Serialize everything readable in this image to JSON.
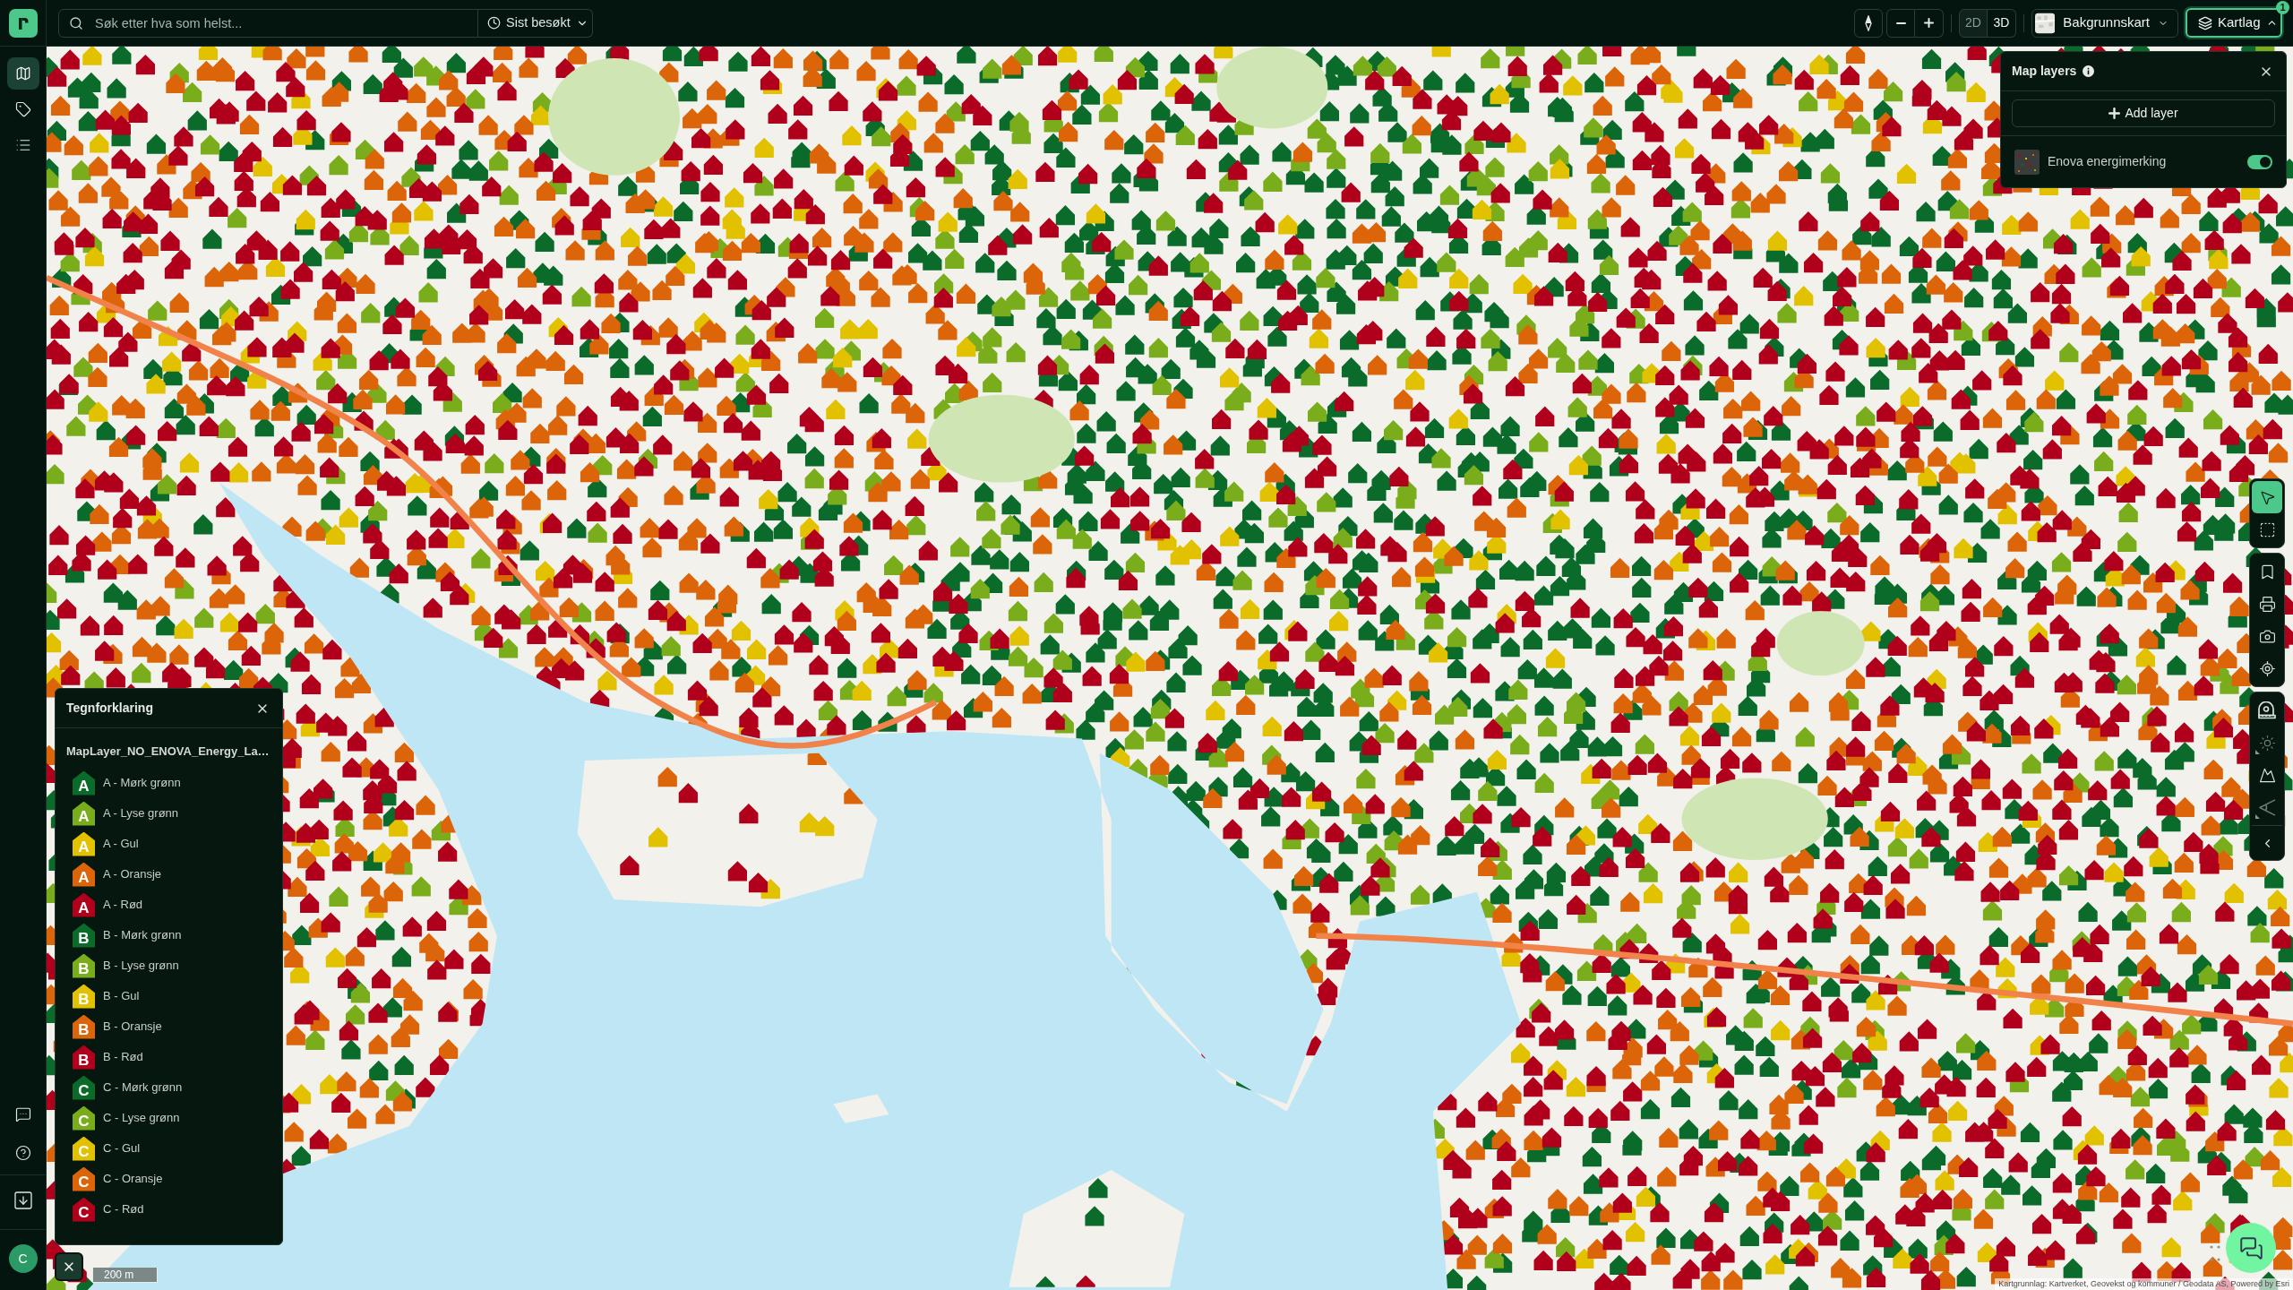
{
  "top_bar": {
    "search": {
      "placeholder": "Søk etter hva som helst...",
      "recent_label": "Sist besøkt"
    },
    "view_modes": [
      {
        "label": "2D",
        "selected": true
      },
      {
        "label": "3D",
        "selected": false
      }
    ],
    "basemap": {
      "label": "Bakgrunnskart",
      "expanded": false
    },
    "layers_button": {
      "label": "Kartlag",
      "expanded": true,
      "badge": "1"
    }
  },
  "sidebar": {
    "nav": [
      {
        "selected": true
      },
      {
        "selected": false
      },
      {
        "selected": false
      }
    ],
    "user": {
      "initial": "C"
    }
  },
  "layers_panel": {
    "title": "Map layers",
    "add_label": "Add layer",
    "layers": [
      {
        "name": "Enova energimerking",
        "on": true
      }
    ]
  },
  "legend": {
    "title": "Tegnforklaring",
    "layer_name": "MapLayer_NO_ENOVA_Energy_La…",
    "items": [
      {
        "letter": "A",
        "label": "A - Mørk grønn",
        "color": "#0b6b2b"
      },
      {
        "letter": "A",
        "label": "A - Lyse grønn",
        "color": "#7aad1b"
      },
      {
        "letter": "A",
        "label": "A - Gul",
        "color": "#e2c100"
      },
      {
        "letter": "A",
        "label": "A - Oransje",
        "color": "#dc6409"
      },
      {
        "letter": "A",
        "label": "A - Rød",
        "color": "#b1001c"
      },
      {
        "letter": "B",
        "label": "B - Mørk grønn",
        "color": "#0b6b2b"
      },
      {
        "letter": "B",
        "label": "B - Lyse grønn",
        "color": "#7aad1b"
      },
      {
        "letter": "B",
        "label": "B - Gul",
        "color": "#e2c100"
      },
      {
        "letter": "B",
        "label": "B - Oransje",
        "color": "#dc6409"
      },
      {
        "letter": "B",
        "label": "B - Rød",
        "color": "#b1001c"
      },
      {
        "letter": "C",
        "label": "C - Mørk grønn",
        "color": "#0b6b2b"
      },
      {
        "letter": "C",
        "label": "C - Lyse grønn",
        "color": "#7aad1b"
      },
      {
        "letter": "C",
        "label": "C - Gul",
        "color": "#e2c100"
      },
      {
        "letter": "C",
        "label": "C - Oransje",
        "color": "#dc6409"
      },
      {
        "letter": "C",
        "label": "C - Rød",
        "color": "#b1001c"
      }
    ]
  },
  "map_tools": [
    [
      {
        "selected": true,
        "disabled": false,
        "flyout": false
      },
      {
        "selected": false,
        "disabled": false,
        "flyout": false
      }
    ],
    [
      {
        "selected": false,
        "disabled": false,
        "flyout": false
      },
      {
        "selected": false,
        "disabled": false,
        "flyout": false
      },
      {
        "selected": false,
        "disabled": false,
        "flyout": false
      },
      {
        "selected": false,
        "disabled": false,
        "flyout": false
      }
    ],
    [
      {
        "selected": false,
        "disabled": false,
        "flyout": false
      },
      {
        "selected": false,
        "disabled": true,
        "flyout": true
      },
      {
        "selected": false,
        "disabled": false,
        "flyout": false
      },
      {
        "selected": false,
        "disabled": true,
        "flyout": true
      }
    ]
  ],
  "map_footer": {
    "scale": "200 m",
    "attribution": "Kartgrunnlag: Kartverket, Geovekst og kommuner / Geodata AS, Powered by Esri"
  }
}
